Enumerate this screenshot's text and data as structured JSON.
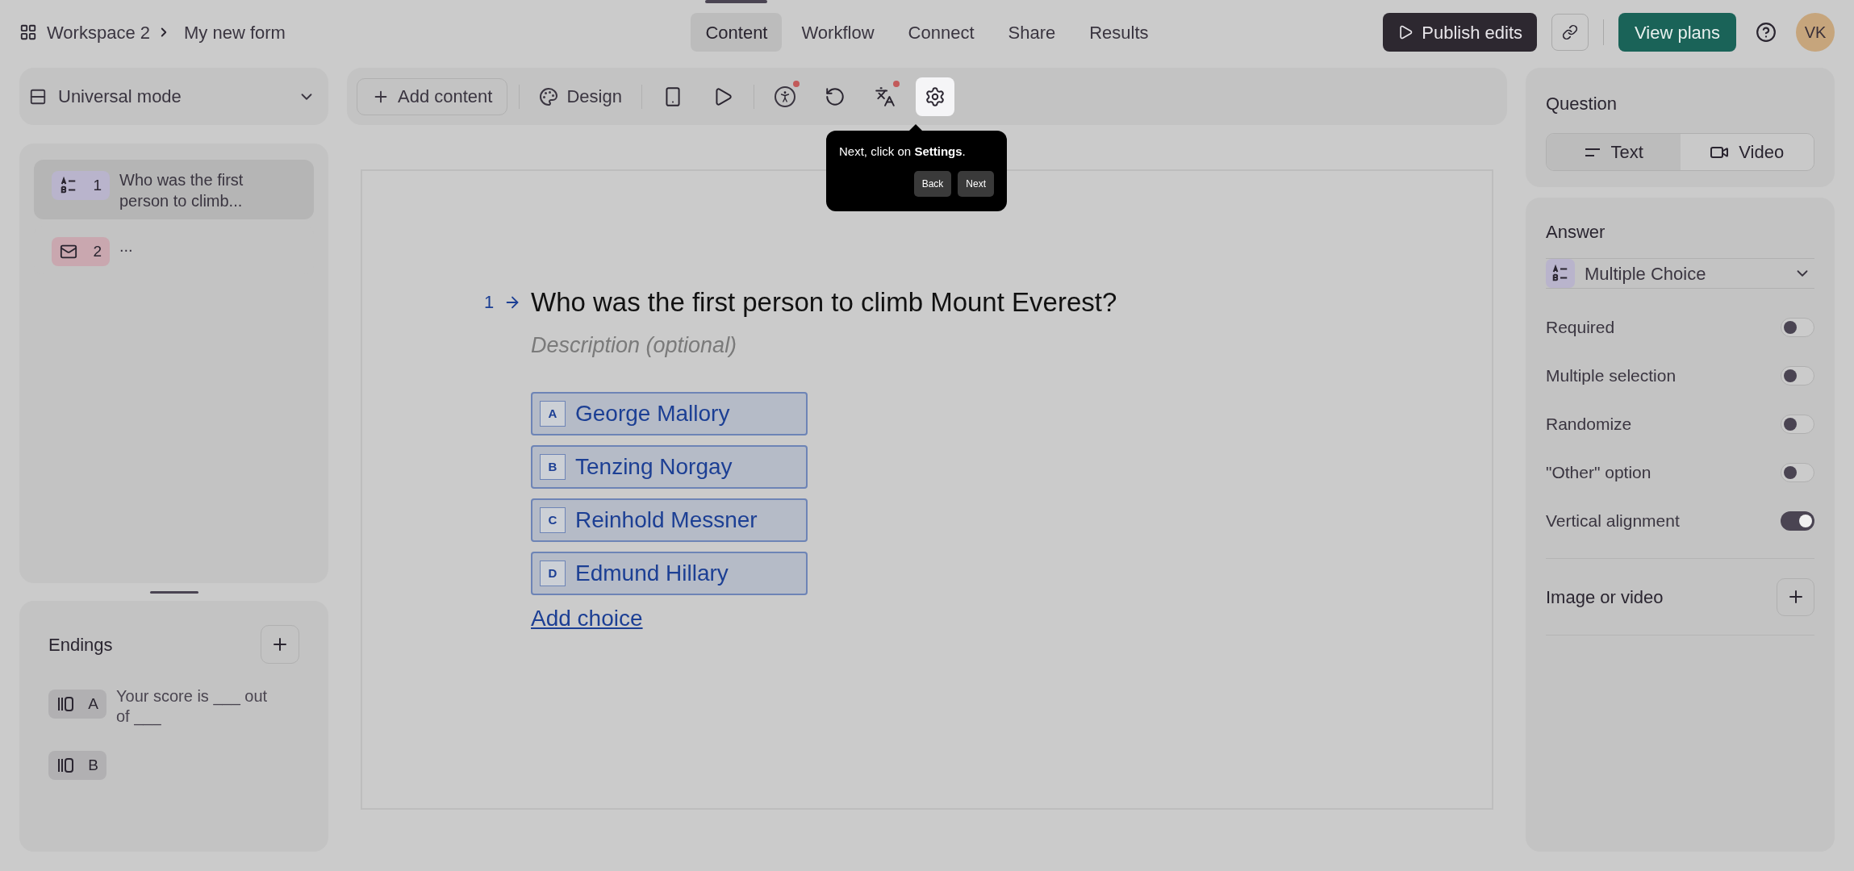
{
  "breadcrumb": {
    "workspace": "Workspace 2",
    "form": "My new form"
  },
  "nav_tabs": [
    {
      "label": "Content",
      "selected": true
    },
    {
      "label": "Workflow",
      "selected": false
    },
    {
      "label": "Connect",
      "selected": false
    },
    {
      "label": "Share",
      "selected": false
    },
    {
      "label": "Results",
      "selected": false
    }
  ],
  "header_actions": {
    "publish": "Publish edits",
    "plans": "View plans",
    "avatar": "VK"
  },
  "mode_select": {
    "value": "Universal mode"
  },
  "toolbar": {
    "add_content": "Add content",
    "design": "Design",
    "tools": [
      {
        "kind": "phone",
        "badge": false,
        "highlighted": false
      },
      {
        "kind": "play",
        "badge": false,
        "highlighted": false
      },
      {
        "kind": "accessibility",
        "badge": true,
        "highlighted": false
      },
      {
        "kind": "logic",
        "badge": false,
        "highlighted": false
      },
      {
        "kind": "translate",
        "badge": true,
        "highlighted": false
      },
      {
        "kind": "settings",
        "badge": false,
        "highlighted": true
      }
    ]
  },
  "questions": [
    {
      "kind": "choice",
      "number": "1",
      "title": "Who was the first person to climb...",
      "selected": true,
      "color": "#b9b4cc"
    },
    {
      "kind": "email",
      "number": "2",
      "title": "...",
      "selected": false,
      "color": "#c9a7af"
    }
  ],
  "endings": {
    "title": "Endings",
    "items": [
      {
        "letter": "A",
        "text": "Your score is ___ out of ___"
      },
      {
        "letter": "B"
      }
    ]
  },
  "question": {
    "number": "1",
    "title": "Who was the first person to climb Mount Everest?",
    "description_placeholder": "Description (optional)",
    "choices": [
      {
        "key": "A",
        "label": "George Mallory"
      },
      {
        "key": "B",
        "label": "Tenzing Norgay"
      },
      {
        "key": "C",
        "label": "Reinhold Messner"
      },
      {
        "key": "D",
        "label": "Edmund Hillary"
      }
    ],
    "add_choice": "Add choice"
  },
  "tooltip": {
    "text": "Next, click on **Settings**.",
    "buttons": [
      "Back",
      "Next"
    ]
  },
  "settings": {
    "question_title": "Question",
    "media_tabs": [
      {
        "kind": "text",
        "label": "Text",
        "selected": true
      },
      {
        "kind": "video",
        "label": "Video",
        "selected": false
      }
    ],
    "answer_title": "Answer",
    "answer_type": "Multiple Choice",
    "toggles": [
      {
        "label": "Required",
        "on": false
      },
      {
        "label": "Multiple selection",
        "on": false
      },
      {
        "label": "Randomize",
        "on": false
      },
      {
        "label": "\"Other\" option",
        "on": false
      },
      {
        "label": "Vertical alignment",
        "on": true
      }
    ],
    "media_title": "Image or video"
  }
}
